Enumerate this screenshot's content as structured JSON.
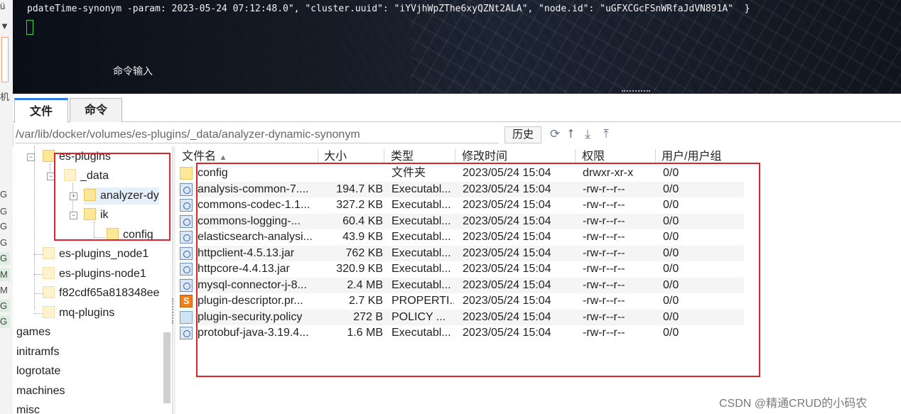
{
  "terminal": {
    "log_line": "pdateTime-synonym -param: 2023-05-24 07:12:48.0\", \"cluster.uuid\": \"iYVjhWpZThe6xyQZNt2ALA\", \"node.id\": \"uGFXCGcFSnWRfaJdVN891A\"  }",
    "command_input_label": "命令输入"
  },
  "left_strip": {
    "chars": [
      "G",
      "G",
      "G",
      "G",
      "G",
      "M",
      "M",
      "G",
      "G"
    ],
    "top_chars": [
      "ü",
      "▼",
      "机"
    ]
  },
  "tabs": [
    {
      "label": "文件",
      "active": true
    },
    {
      "label": "命令",
      "active": false
    }
  ],
  "path_bar": {
    "path": "/var/lib/docker/volumes/es-plugins/_data/analyzer-dynamic-synonym",
    "history_label": "历史",
    "icons": [
      "refresh-icon",
      "upload-arrow-icon",
      "download-icon",
      "upload-icon"
    ]
  },
  "tree": {
    "items": [
      {
        "label": "es-plugins"
      },
      {
        "label": "_data"
      },
      {
        "label": "analyzer-dy"
      },
      {
        "label": "ik"
      },
      {
        "label": "config"
      },
      {
        "label": "es-plugins_node1"
      },
      {
        "label": "es-plugins-node1"
      },
      {
        "label": "f82cdf65a818348ee"
      },
      {
        "label": "mq-plugins"
      },
      {
        "label": "games"
      },
      {
        "label": "initramfs"
      },
      {
        "label": "logrotate"
      },
      {
        "label": "machines"
      },
      {
        "label": "misc"
      }
    ]
  },
  "file_list": {
    "columns": [
      "文件名",
      "大小",
      "类型",
      "修改时间",
      "权限",
      "用户/用户组"
    ],
    "rows": [
      {
        "name": "config",
        "size": "",
        "type": "文件夹",
        "mtime": "2023/05/24 15:04",
        "perm": "drwxr-xr-x",
        "owner": "0/0",
        "icon": "folder-icon"
      },
      {
        "name": "analysis-common-7....",
        "size": "194.7 KB",
        "type": "Executabl...",
        "mtime": "2023/05/24 15:04",
        "perm": "-rw-r--r--",
        "owner": "0/0",
        "icon": "jar-file-icon"
      },
      {
        "name": "commons-codec-1.1...",
        "size": "327.2 KB",
        "type": "Executabl...",
        "mtime": "2023/05/24 15:04",
        "perm": "-rw-r--r--",
        "owner": "0/0",
        "icon": "jar-file-icon"
      },
      {
        "name": "commons-logging-...",
        "size": "60.4 KB",
        "type": "Executabl...",
        "mtime": "2023/05/24 15:04",
        "perm": "-rw-r--r--",
        "owner": "0/0",
        "icon": "jar-file-icon"
      },
      {
        "name": "elasticsearch-analysi...",
        "size": "43.9 KB",
        "type": "Executabl...",
        "mtime": "2023/05/24 15:04",
        "perm": "-rw-r--r--",
        "owner": "0/0",
        "icon": "jar-file-icon"
      },
      {
        "name": "httpclient-4.5.13.jar",
        "size": "762 KB",
        "type": "Executabl...",
        "mtime": "2023/05/24 15:04",
        "perm": "-rw-r--r--",
        "owner": "0/0",
        "icon": "jar-file-icon"
      },
      {
        "name": "httpcore-4.4.13.jar",
        "size": "320.9 KB",
        "type": "Executabl...",
        "mtime": "2023/05/24 15:04",
        "perm": "-rw-r--r--",
        "owner": "0/0",
        "icon": "jar-file-icon"
      },
      {
        "name": "mysql-connector-j-8...",
        "size": "2.4 MB",
        "type": "Executabl...",
        "mtime": "2023/05/24 15:04",
        "perm": "-rw-r--r--",
        "owner": "0/0",
        "icon": "jar-file-icon"
      },
      {
        "name": "plugin-descriptor.pr...",
        "size": "2.7 KB",
        "type": "PROPERTI...",
        "mtime": "2023/05/24 15:04",
        "perm": "-rw-r--r--",
        "owner": "0/0",
        "icon": "properties-file-icon"
      },
      {
        "name": "plugin-security.policy",
        "size": "272 B",
        "type": "POLICY ...",
        "mtime": "2023/05/24 15:04",
        "perm": "-rw-r--r--",
        "owner": "0/0",
        "icon": "policy-file-icon"
      },
      {
        "name": "protobuf-java-3.19.4...",
        "size": "1.6 MB",
        "type": "Executabl...",
        "mtime": "2023/05/24 15:04",
        "perm": "-rw-r--r--",
        "owner": "0/0",
        "icon": "jar-file-icon"
      }
    ]
  },
  "watermark": "CSDN @精通CRUD的小码农",
  "colors": {
    "highlight_box": "#d9252b",
    "tab_accent": "#2b7de1",
    "folder": "#ffe79a"
  }
}
